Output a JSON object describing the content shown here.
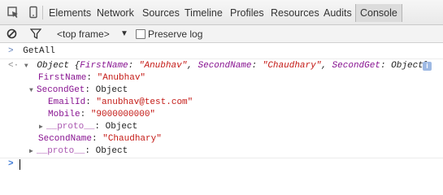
{
  "toolbar": {
    "tabs": [
      "Elements",
      "Network",
      "Sources",
      "Timeline",
      "Profiles",
      "Resources",
      "Audits",
      "Console"
    ],
    "active_tab": "Console"
  },
  "filter_bar": {
    "frame_selector": "<top frame>",
    "preserve_log_label": "Preserve log",
    "preserve_log_checked": false
  },
  "console": {
    "command": "GetAll",
    "object_header": {
      "type": "Object",
      "open_brace": "{",
      "k1": "FirstName",
      "v1": "\"Anubhav\"",
      "k2": "SecondName",
      "v2": "\"Chaudhary\"",
      "k3": "SecondGet",
      "v3": "Object",
      "close_brace": "}",
      "sep": ": ",
      "comma": ", "
    },
    "first_name_key": "FirstName",
    "first_name_value": "\"Anubhav\"",
    "second_get_key": "SecondGet",
    "second_get_value": "Object",
    "email_key": "EmailId",
    "email_value": "\"anubhav@test.com\"",
    "mobile_key": "Mobile",
    "mobile_value": "\"9000000000\"",
    "proto_key": "__proto__",
    "proto_value": "Object",
    "second_name_key": "SecondName",
    "second_name_value": "\"Chaudhary\"",
    "info_badge": "i"
  }
}
